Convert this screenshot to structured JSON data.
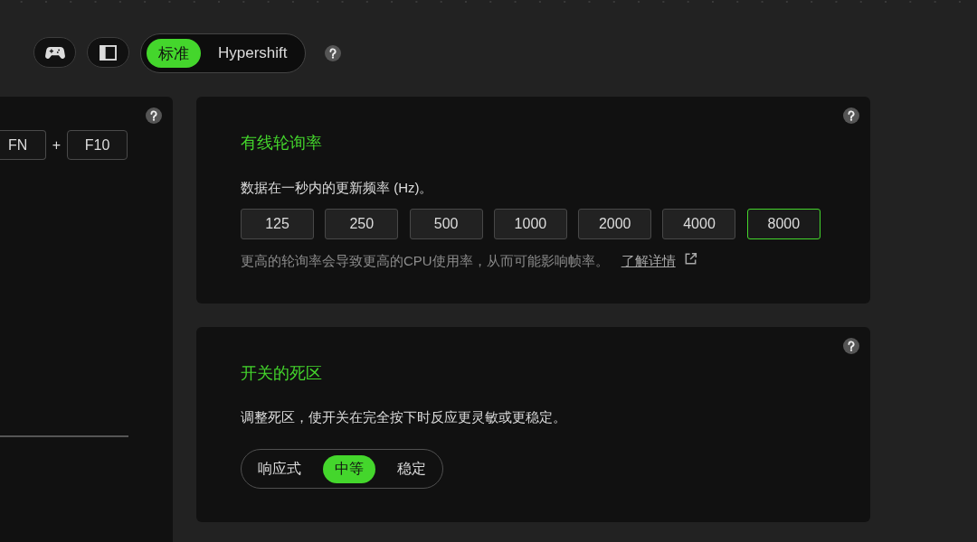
{
  "toolbar": {
    "mode_switch": [
      {
        "label": "标准",
        "selected": true
      },
      {
        "label": "Hypershift",
        "selected": false
      }
    ]
  },
  "shortcut": {
    "keys": [
      "FN",
      "F10"
    ],
    "separator": "+"
  },
  "cards": [
    {
      "kind": "buttons",
      "title": "有线轮询率",
      "description": "数据在一秒内的更新频率 (Hz)。",
      "options": [
        {
          "label": "125",
          "selected": false
        },
        {
          "label": "250",
          "selected": false
        },
        {
          "label": "500",
          "selected": false
        },
        {
          "label": "1000",
          "selected": false
        },
        {
          "label": "2000",
          "selected": false
        },
        {
          "label": "4000",
          "selected": false
        },
        {
          "label": "8000",
          "selected": true
        }
      ],
      "note": "更高的轮询率会导致更高的CPU使用率，从而可能影响帧率。",
      "link": "了解详情"
    },
    {
      "kind": "segmented",
      "title": "开关的死区",
      "description": "调整死区，使开关在完全按下时反应更灵敏或更稳定。",
      "options": [
        {
          "label": "响应式",
          "selected": false
        },
        {
          "label": "中等",
          "selected": true
        },
        {
          "label": "稳定",
          "selected": false
        }
      ]
    }
  ]
}
